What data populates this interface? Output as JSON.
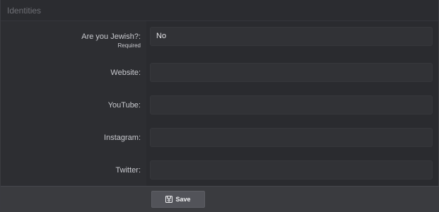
{
  "panel": {
    "title": "Identities"
  },
  "fields": {
    "jewish": {
      "label": "Are you Jewish?:",
      "sublabel": "Required",
      "value": "No"
    },
    "website": {
      "label": "Website:",
      "value": ""
    },
    "youtube": {
      "label": "YouTube:",
      "value": ""
    },
    "instagram": {
      "label": "Instagram:",
      "value": ""
    },
    "twitter": {
      "label": "Twitter:",
      "value": ""
    }
  },
  "footer": {
    "save_label": "Save",
    "save_icon": "floppy-disk-icon"
  }
}
